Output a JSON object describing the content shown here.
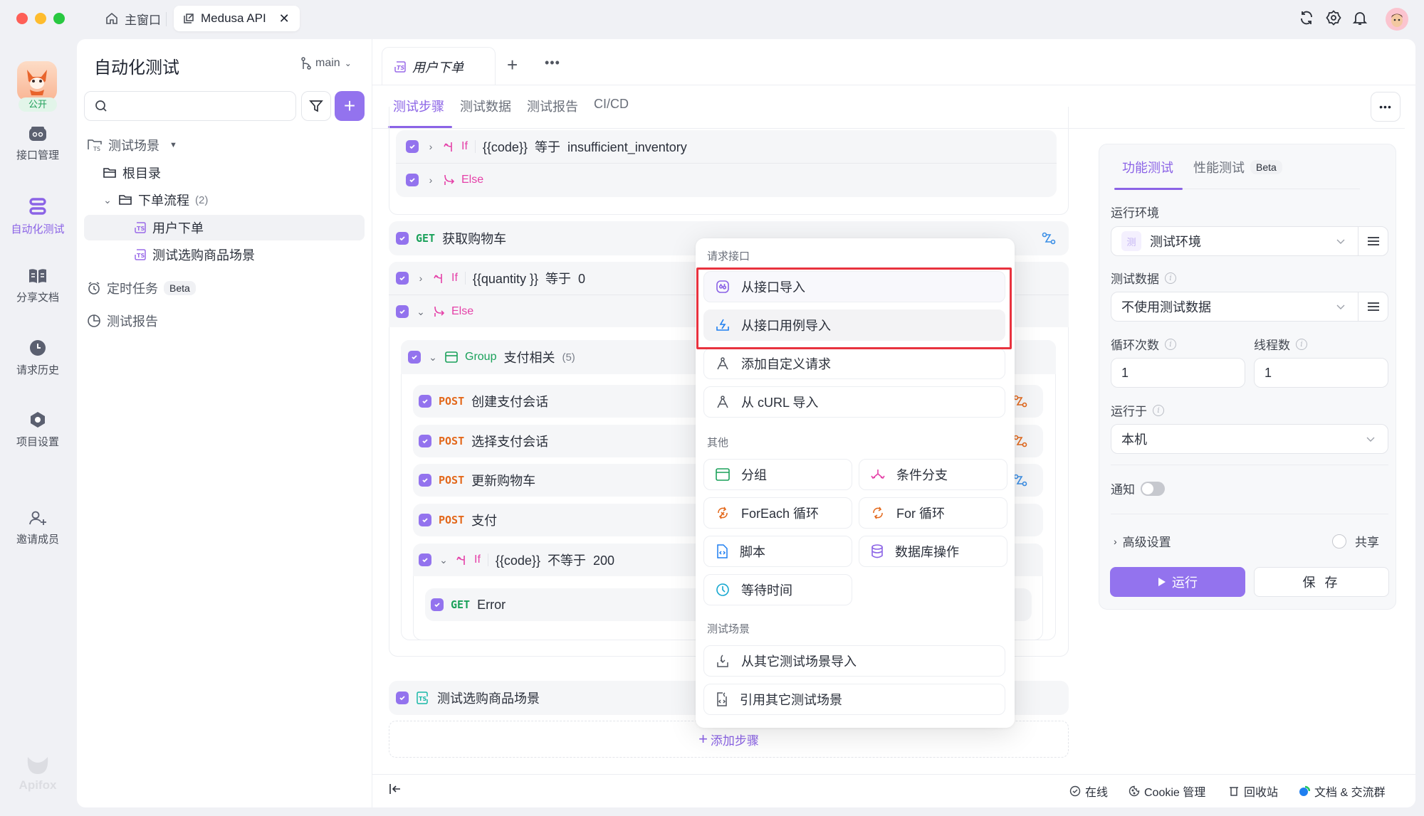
{
  "titlebar": {
    "home_tab": "主窗口",
    "project_tab": "Medusa API",
    "icons": [
      "refresh-icon",
      "settings-icon",
      "bell-icon",
      "user-avatar"
    ]
  },
  "rail": {
    "public_badge": "公开",
    "items": [
      {
        "label": "接口管理",
        "icon": "api-icon",
        "active": false
      },
      {
        "label": "自动化测试",
        "icon": "automation-icon",
        "active": true
      },
      {
        "label": "分享文档",
        "icon": "book-icon",
        "active": false
      },
      {
        "label": "请求历史",
        "icon": "clock-icon",
        "active": false
      },
      {
        "label": "项目设置",
        "icon": "hexagon-icon",
        "active": false
      },
      {
        "label": "邀请成员",
        "icon": "user-plus-icon",
        "active": false
      }
    ],
    "brand": "Apifox"
  },
  "tree": {
    "title": "自动化测试",
    "branch": "main",
    "search_placeholder": "",
    "sections": {
      "scenarios": "测试场景",
      "root": "根目录",
      "folder": "下单流程",
      "folder_count": "(2)",
      "items": [
        "用户下单",
        "测试选购商品场景"
      ],
      "scheduled": "定时任务",
      "scheduled_badge": "Beta",
      "reports": "测试报告"
    }
  },
  "editor": {
    "doc_tab": "用户下单",
    "sub_tabs": [
      "测试步骤",
      "测试数据",
      "测试报告",
      "CI/CD"
    ],
    "active_sub_tab": "测试步骤",
    "steps": {
      "if1": {
        "keyword": "If",
        "condition": "{{code}}  等于  insufficient_inventory"
      },
      "else1": {
        "keyword": "Else"
      },
      "get_cart": {
        "method": "GET",
        "name": "获取购物车"
      },
      "if2": {
        "keyword": "If",
        "condition": "{{quantity }}  等于  0"
      },
      "else2": {
        "keyword": "Else"
      },
      "group": {
        "keyword": "Group",
        "name": "支付相关",
        "count": "(5)"
      },
      "posts": [
        {
          "method": "POST",
          "name": "创建支付会话"
        },
        {
          "method": "POST",
          "name": "选择支付会话"
        },
        {
          "method": "POST",
          "name": "更新购物车"
        },
        {
          "method": "POST",
          "name": "支付"
        }
      ],
      "if3": {
        "keyword": "If",
        "condition": "{{code}}  不等于  200"
      },
      "error_get": {
        "method": "GET",
        "name": "Error"
      },
      "ref_scenario": {
        "name": "测试选购商品场景"
      }
    },
    "add_step": "添加步骤"
  },
  "menu": {
    "section_request": "请求接口",
    "request_items": [
      "从接口导入",
      "从接口用例导入",
      "添加自定义请求",
      "从 cURL 导入"
    ],
    "section_other": "其他",
    "other_items": [
      "分组",
      "条件分支",
      "ForEach 循环",
      "For 循环",
      "脚本",
      "数据库操作",
      "等待时间"
    ],
    "section_scenario": "测试场景",
    "scenario_items": [
      "从其它测试场景导入",
      "引用其它测试场景"
    ]
  },
  "config": {
    "tabs": [
      "功能测试",
      "性能测试"
    ],
    "perf_badge": "Beta",
    "env_label": "运行环境",
    "env_tag": "测",
    "env_value": "测试环境",
    "data_label": "测试数据",
    "data_value": "不使用测试数据",
    "loops_label": "循环次数",
    "loops_value": "1",
    "threads_label": "线程数",
    "threads_value": "1",
    "run_on_label": "运行于",
    "run_on_value": "本机",
    "notify_label": "通知",
    "notify_on": false,
    "advanced_label": "高级设置",
    "share_label": "共享",
    "run_button": "运行",
    "save_button": "保 存"
  },
  "statusbar": {
    "online": "在线",
    "cookie": "Cookie 管理",
    "trash": "回收站",
    "docs": "文档 & 交流群"
  },
  "colors": {
    "accent": "#9373ee",
    "get": "#1aa15a",
    "post": "#e3681b",
    "if": "#e541a8",
    "highlight_frame": "#e8323e"
  }
}
